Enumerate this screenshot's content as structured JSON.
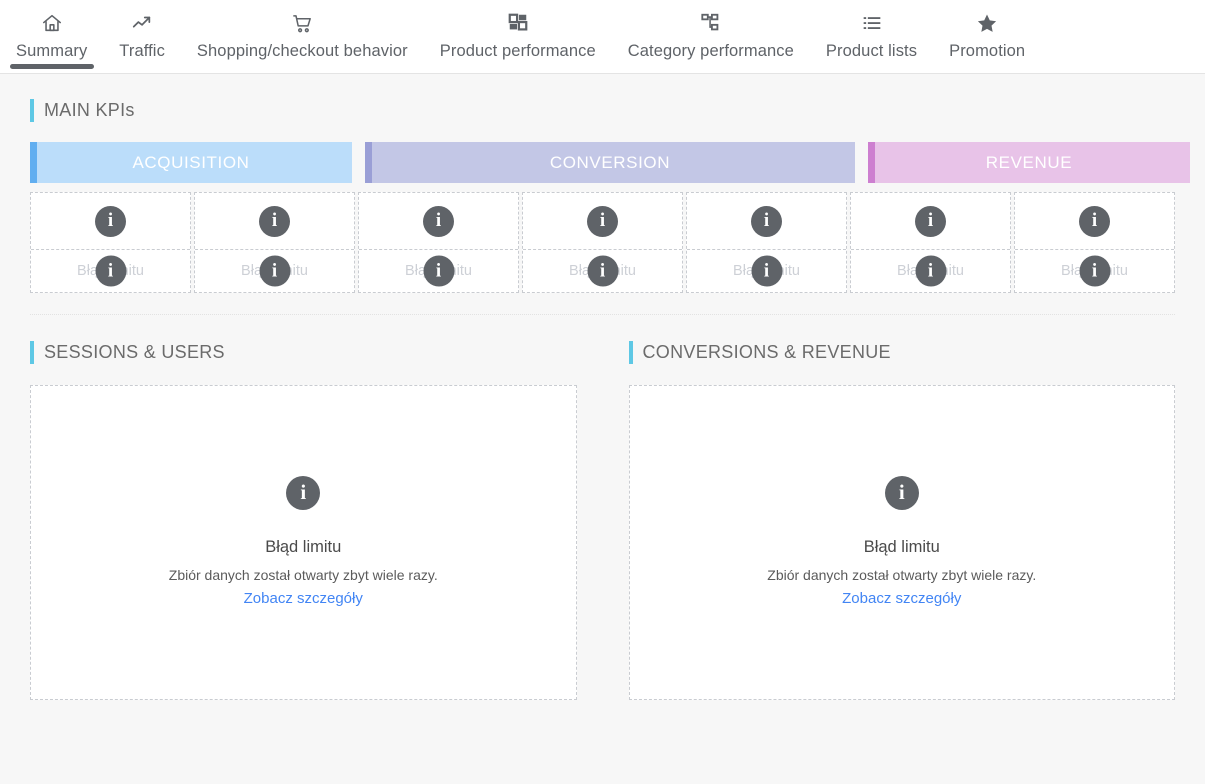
{
  "nav": {
    "tabs": [
      {
        "label": "Summary",
        "icon": "home-icon",
        "active": true
      },
      {
        "label": "Traffic",
        "icon": "trend-up-icon",
        "active": false
      },
      {
        "label": "Shopping/checkout behavior",
        "icon": "shopping-cart-icon",
        "active": false
      },
      {
        "label": "Product performance",
        "icon": "grid-dashboard-icon",
        "active": false
      },
      {
        "label": "Category performance",
        "icon": "hierarchy-icon",
        "active": false
      },
      {
        "label": "Product lists",
        "icon": "list-icon",
        "active": false
      },
      {
        "label": "Promotion",
        "icon": "star-icon",
        "active": false
      }
    ]
  },
  "main_kpis": {
    "section_title": "MAIN KPIs",
    "banners": [
      {
        "label": "ACQUISITION",
        "bg": "#bbddfa",
        "accent": "#61aef0"
      },
      {
        "label": "CONVERSION",
        "bg": "#c3c7e6",
        "accent": "#9a9fd6"
      },
      {
        "label": "REVENUE",
        "bg": "#e8c3e8",
        "accent": "#cd7fd0"
      }
    ],
    "cards": [
      {
        "error_label": "Błąd limitu",
        "icon": "info-icon"
      },
      {
        "error_label": "Błąd limitu",
        "icon": "info-icon"
      },
      {
        "error_label": "Błąd limitu",
        "icon": "info-icon"
      },
      {
        "error_label": "Błąd limitu",
        "icon": "info-icon"
      },
      {
        "error_label": "Błąd limitu",
        "icon": "info-icon"
      },
      {
        "error_label": "Błąd limitu",
        "icon": "info-icon"
      },
      {
        "error_label": "Błąd limitu",
        "icon": "info-icon"
      }
    ]
  },
  "sessions_users": {
    "section_title": "SESSIONS & USERS",
    "card": {
      "icon": "info-icon",
      "title": "Błąd limitu",
      "description": "Zbiór danych został otwarty zbyt wiele razy.",
      "link": "Zobacz szczegóły"
    }
  },
  "conversions_revenue": {
    "section_title": "CONVERSIONS & REVENUE",
    "card": {
      "icon": "info-icon",
      "title": "Błąd limitu",
      "description": "Zbiór danych został otwarty zbyt wiele razy.",
      "link": "Zobacz szczegóły"
    }
  },
  "theme": {
    "page_bg": "#f7f7f7",
    "card_bg": "#ffffff",
    "accent_cyan": "#5ec8e5",
    "link_blue": "#4285f4",
    "icon_gray": "#5f6368",
    "dashed_border": "#c9ccd1"
  }
}
